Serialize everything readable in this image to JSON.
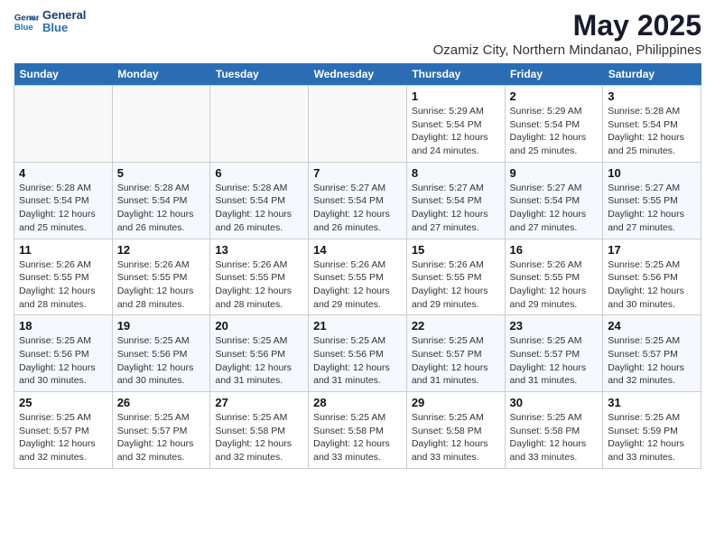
{
  "logo": {
    "line1": "General",
    "line2": "Blue"
  },
  "title": "May 2025",
  "subtitle": "Ozamiz City, Northern Mindanao, Philippines",
  "days": [
    "Sunday",
    "Monday",
    "Tuesday",
    "Wednesday",
    "Thursday",
    "Friday",
    "Saturday"
  ],
  "weeks": [
    [
      {
        "date": "",
        "info": ""
      },
      {
        "date": "",
        "info": ""
      },
      {
        "date": "",
        "info": ""
      },
      {
        "date": "",
        "info": ""
      },
      {
        "date": "1",
        "info": "Sunrise: 5:29 AM\nSunset: 5:54 PM\nDaylight: 12 hours\nand 24 minutes."
      },
      {
        "date": "2",
        "info": "Sunrise: 5:29 AM\nSunset: 5:54 PM\nDaylight: 12 hours\nand 25 minutes."
      },
      {
        "date": "3",
        "info": "Sunrise: 5:28 AM\nSunset: 5:54 PM\nDaylight: 12 hours\nand 25 minutes."
      }
    ],
    [
      {
        "date": "4",
        "info": "Sunrise: 5:28 AM\nSunset: 5:54 PM\nDaylight: 12 hours\nand 25 minutes."
      },
      {
        "date": "5",
        "info": "Sunrise: 5:28 AM\nSunset: 5:54 PM\nDaylight: 12 hours\nand 26 minutes."
      },
      {
        "date": "6",
        "info": "Sunrise: 5:28 AM\nSunset: 5:54 PM\nDaylight: 12 hours\nand 26 minutes."
      },
      {
        "date": "7",
        "info": "Sunrise: 5:27 AM\nSunset: 5:54 PM\nDaylight: 12 hours\nand 26 minutes."
      },
      {
        "date": "8",
        "info": "Sunrise: 5:27 AM\nSunset: 5:54 PM\nDaylight: 12 hours\nand 27 minutes."
      },
      {
        "date": "9",
        "info": "Sunrise: 5:27 AM\nSunset: 5:54 PM\nDaylight: 12 hours\nand 27 minutes."
      },
      {
        "date": "10",
        "info": "Sunrise: 5:27 AM\nSunset: 5:55 PM\nDaylight: 12 hours\nand 27 minutes."
      }
    ],
    [
      {
        "date": "11",
        "info": "Sunrise: 5:26 AM\nSunset: 5:55 PM\nDaylight: 12 hours\nand 28 minutes."
      },
      {
        "date": "12",
        "info": "Sunrise: 5:26 AM\nSunset: 5:55 PM\nDaylight: 12 hours\nand 28 minutes."
      },
      {
        "date": "13",
        "info": "Sunrise: 5:26 AM\nSunset: 5:55 PM\nDaylight: 12 hours\nand 28 minutes."
      },
      {
        "date": "14",
        "info": "Sunrise: 5:26 AM\nSunset: 5:55 PM\nDaylight: 12 hours\nand 29 minutes."
      },
      {
        "date": "15",
        "info": "Sunrise: 5:26 AM\nSunset: 5:55 PM\nDaylight: 12 hours\nand 29 minutes."
      },
      {
        "date": "16",
        "info": "Sunrise: 5:26 AM\nSunset: 5:55 PM\nDaylight: 12 hours\nand 29 minutes."
      },
      {
        "date": "17",
        "info": "Sunrise: 5:25 AM\nSunset: 5:56 PM\nDaylight: 12 hours\nand 30 minutes."
      }
    ],
    [
      {
        "date": "18",
        "info": "Sunrise: 5:25 AM\nSunset: 5:56 PM\nDaylight: 12 hours\nand 30 minutes."
      },
      {
        "date": "19",
        "info": "Sunrise: 5:25 AM\nSunset: 5:56 PM\nDaylight: 12 hours\nand 30 minutes."
      },
      {
        "date": "20",
        "info": "Sunrise: 5:25 AM\nSunset: 5:56 PM\nDaylight: 12 hours\nand 31 minutes."
      },
      {
        "date": "21",
        "info": "Sunrise: 5:25 AM\nSunset: 5:56 PM\nDaylight: 12 hours\nand 31 minutes."
      },
      {
        "date": "22",
        "info": "Sunrise: 5:25 AM\nSunset: 5:57 PM\nDaylight: 12 hours\nand 31 minutes."
      },
      {
        "date": "23",
        "info": "Sunrise: 5:25 AM\nSunset: 5:57 PM\nDaylight: 12 hours\nand 31 minutes."
      },
      {
        "date": "24",
        "info": "Sunrise: 5:25 AM\nSunset: 5:57 PM\nDaylight: 12 hours\nand 32 minutes."
      }
    ],
    [
      {
        "date": "25",
        "info": "Sunrise: 5:25 AM\nSunset: 5:57 PM\nDaylight: 12 hours\nand 32 minutes."
      },
      {
        "date": "26",
        "info": "Sunrise: 5:25 AM\nSunset: 5:57 PM\nDaylight: 12 hours\nand 32 minutes."
      },
      {
        "date": "27",
        "info": "Sunrise: 5:25 AM\nSunset: 5:58 PM\nDaylight: 12 hours\nand 32 minutes."
      },
      {
        "date": "28",
        "info": "Sunrise: 5:25 AM\nSunset: 5:58 PM\nDaylight: 12 hours\nand 33 minutes."
      },
      {
        "date": "29",
        "info": "Sunrise: 5:25 AM\nSunset: 5:58 PM\nDaylight: 12 hours\nand 33 minutes."
      },
      {
        "date": "30",
        "info": "Sunrise: 5:25 AM\nSunset: 5:58 PM\nDaylight: 12 hours\nand 33 minutes."
      },
      {
        "date": "31",
        "info": "Sunrise: 5:25 AM\nSunset: 5:59 PM\nDaylight: 12 hours\nand 33 minutes."
      }
    ]
  ]
}
